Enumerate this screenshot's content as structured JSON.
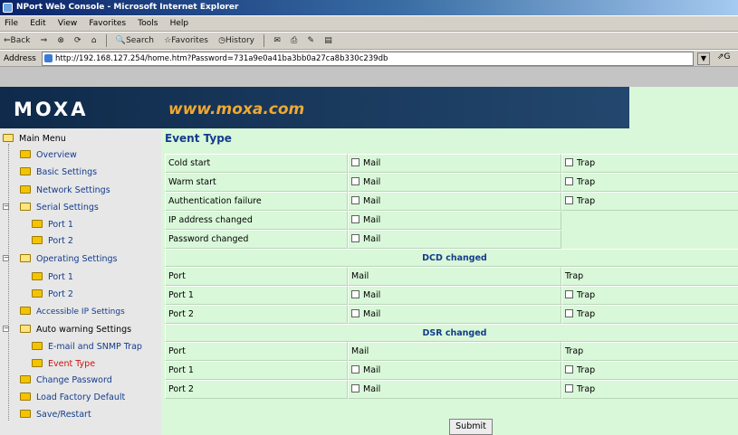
{
  "window": {
    "title": "NPort Web Console - Microsoft Internet Explorer"
  },
  "menubar": [
    "File",
    "Edit",
    "View",
    "Favorites",
    "Tools",
    "Help"
  ],
  "toolbar": {
    "back": "⇐Back",
    "forward": "⇒",
    "search": "Search",
    "favorites": "Favorites",
    "history": "History"
  },
  "address": {
    "label": "Address",
    "url": "http://192.168.127.254/home.htm?Password=731a9e0a41ba3bb0a27ca8b330c239db",
    "go": "⇗G"
  },
  "header": {
    "logo": "MOXA",
    "site": "www.moxa.com"
  },
  "sidebar": {
    "main_menu": "Main Menu",
    "items": [
      {
        "label": "Overview"
      },
      {
        "label": "Basic Settings"
      },
      {
        "label": "Network Settings"
      },
      {
        "label": "Serial Settings"
      },
      {
        "label": "Port 1"
      },
      {
        "label": "Port 2"
      },
      {
        "label": "Operating Settings"
      },
      {
        "label": "Port 1"
      },
      {
        "label": "Port 2"
      },
      {
        "label": "Accessible IP Settings"
      },
      {
        "label": "Auto warning Settings"
      },
      {
        "label": "E-mail and SNMP Trap"
      },
      {
        "label": "Event Type"
      },
      {
        "label": "Change Password"
      },
      {
        "label": "Load Factory Default"
      },
      {
        "label": "Save/Restart"
      }
    ]
  },
  "page": {
    "title": "Event Type",
    "events": [
      {
        "name": "Cold start",
        "mail": "Mail",
        "trap": "Trap"
      },
      {
        "name": "Warm start",
        "mail": "Mail",
        "trap": "Trap"
      },
      {
        "name": "Authentication failure",
        "mail": "Mail",
        "trap": "Trap"
      },
      {
        "name": "IP address changed",
        "mail": "Mail"
      },
      {
        "name": "Password changed",
        "mail": "Mail"
      }
    ],
    "dcd": {
      "heading": "DCD changed",
      "col_port": "Port",
      "col_mail": "Mail",
      "col_trap": "Trap",
      "rows": [
        {
          "port": "Port 1",
          "mail": "Mail",
          "trap": "Trap"
        },
        {
          "port": "Port 2",
          "mail": "Mail",
          "trap": "Trap"
        }
      ]
    },
    "dsr": {
      "heading": "DSR changed",
      "col_port": "Port",
      "col_mail": "Mail",
      "col_trap": "Trap",
      "rows": [
        {
          "port": "Port 1",
          "mail": "Mail",
          "trap": "Trap"
        },
        {
          "port": "Port 2",
          "mail": "Mail",
          "trap": "Trap"
        }
      ]
    },
    "submit": "Submit"
  }
}
